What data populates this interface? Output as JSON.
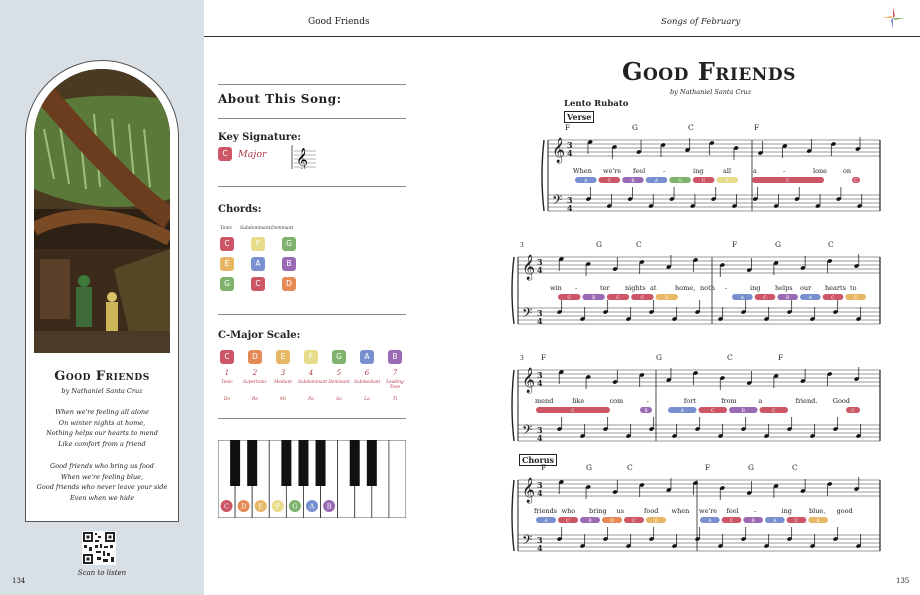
{
  "colors": {
    "C": "#cc5566",
    "D": "#e58a57",
    "E": "#e8b765",
    "F": "#e6dc8a",
    "G": "#7fb36d",
    "A": "#7890cf",
    "B": "#9a6ab5"
  },
  "header": {
    "left": "Good Friends",
    "right": "Songs of February"
  },
  "left_page": {
    "card_title": "Good Friends",
    "card_author": "by Nathaniel Santa Cruz",
    "lyrics_verse": [
      "When we're feeling all alone",
      "On winter nights at home,",
      "Nothing helps our hearts to mend",
      "Like comfort from a friend"
    ],
    "lyrics_chorus": [
      "Good friends who bring us food",
      "When we're feeling blue,",
      "Good friends who never leave your side",
      "Even when we hide"
    ],
    "scan_label": "Scan to listen",
    "page_number": "134"
  },
  "about": {
    "title": "About This Song:",
    "key_label": "Key Signature:",
    "key_note": "C",
    "key_mode": "Major",
    "chords_label": "Chords:",
    "chord_headers": [
      "Tonic",
      "Subdominant",
      "Dominant"
    ],
    "chord_rows": [
      [
        "C",
        "F",
        "G"
      ],
      [
        "E",
        "A",
        "B"
      ],
      [
        "G",
        "C",
        "D"
      ]
    ],
    "scale_label": "C-Major Scale:",
    "scale_notes": [
      "C",
      "D",
      "E",
      "F",
      "G",
      "A",
      "B"
    ],
    "scale_numbers": [
      "1",
      "2",
      "3",
      "4",
      "5",
      "6",
      "7"
    ],
    "scale_functions": [
      "Tonic",
      "Supertonic",
      "Mediant",
      "Subdominant",
      "Dominant",
      "Submediant",
      "Leading Tone"
    ],
    "solfege": [
      "Do",
      "Re",
      "Mi",
      "Fa",
      "So",
      "La",
      "Ti"
    ],
    "piano_keys": [
      "C",
      "D",
      "E",
      "F",
      "G",
      "A",
      "B"
    ]
  },
  "score": {
    "title": "Good Friends",
    "author": "by Nathaniel Santa Cruz",
    "tempo": "Lento Rubato",
    "verse_label": "Verse",
    "chorus_label": "Chorus",
    "page_number": "135",
    "systems": [
      {
        "measure_number": "",
        "chords": [
          "F",
          "G",
          "C",
          "F"
        ],
        "lyrics": [
          "When",
          "we're",
          "feel",
          "-",
          "ing",
          "all",
          "a",
          "-",
          "lone",
          "on"
        ],
        "note_pills": [
          [
            "A",
            "C",
            "B",
            "A",
            "G",
            "C",
            "F"
          ],
          [
            "C"
          ],
          [
            "C"
          ]
        ]
      },
      {
        "measure_number": "3",
        "chords": [
          "G",
          "C",
          "F",
          "G",
          "C"
        ],
        "lyrics": [
          "win",
          "-",
          "ter",
          "nights",
          "at",
          "home,",
          "noth",
          "-",
          "ing",
          "helps",
          "our",
          "hearts",
          "to"
        ],
        "note_pills": [
          [
            "C",
            "B",
            "C",
            "C",
            "E"
          ],
          [
            "A",
            "C",
            "B",
            "A",
            "C",
            "E"
          ]
        ]
      },
      {
        "measure_number": "3",
        "chords": [
          "F",
          "G",
          "C",
          "F"
        ],
        "lyrics": [
          "mend",
          "like",
          "com",
          "-",
          "fort",
          "from",
          "a",
          "friend.",
          "Good"
        ],
        "note_pills": [
          [
            "C"
          ],
          [
            "B"
          ],
          [
            "A",
            "C",
            "B",
            "C"
          ],
          [
            "C"
          ]
        ]
      },
      {
        "measure_number": "",
        "chords": [
          "F",
          "G",
          "C",
          "F",
          "G",
          "C"
        ],
        "lyrics": [
          "friends",
          "who",
          "bring",
          "us",
          "food",
          "when",
          "we're",
          "feel",
          "-",
          "ing",
          "blue,",
          "good"
        ],
        "note_pills": [
          [
            "A",
            "C",
            "B",
            "D",
            "C",
            "E"
          ],
          [
            "A",
            "C",
            "B",
            "A",
            "C",
            "E"
          ]
        ]
      }
    ]
  }
}
